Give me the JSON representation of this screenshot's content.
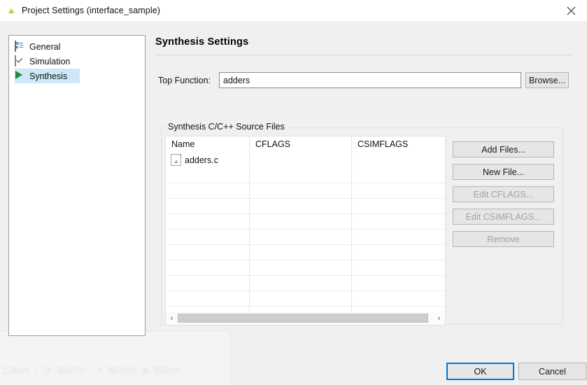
{
  "window": {
    "title": "Project Settings (interface_sample)",
    "icon": "app-icon",
    "close_label": "✕"
  },
  "sidebar": {
    "items": [
      {
        "label": "General",
        "icon": "list-icon",
        "selected": false
      },
      {
        "label": "Simulation",
        "icon": "checkbox-icon",
        "selected": false
      },
      {
        "label": "Synthesis",
        "icon": "play-icon",
        "selected": true
      }
    ]
  },
  "main": {
    "heading": "Synthesis Settings",
    "top_function": {
      "label": "Top Function:",
      "value": "adders",
      "placeholder": "",
      "browse_label": "Browse..."
    },
    "group": {
      "legend": "Synthesis C/C++ Source Files",
      "table": {
        "columns": [
          "Name",
          "CFLAGS",
          "CSIMFLAGS"
        ],
        "rows": [
          {
            "name": "adders.c",
            "icon": "c-file-icon",
            "cflags": "",
            "csimflags": ""
          }
        ],
        "empty_row_count": 10,
        "scrollbar": {
          "left_arrow": "‹",
          "right_arrow": "›"
        }
      },
      "actions": [
        {
          "label": "Add Files...",
          "enabled": true
        },
        {
          "label": "New File...",
          "enabled": true
        },
        {
          "label": "Edit CFLAGS...",
          "enabled": false
        },
        {
          "label": "Edit CSIMFLAGS...",
          "enabled": false
        },
        {
          "label": "Remove",
          "enabled": false
        }
      ]
    }
  },
  "footer": {
    "ok_label": "OK",
    "cancel_label": "Cancel"
  },
  "background": {
    "ghost_items": [
      "工具(M)",
      "▾",
      "调试(D)",
      "▾",
      "窗口(W)",
      "帮助(H)"
    ]
  },
  "colors": {
    "accent": "#0078d7",
    "selection": "#cde8f8",
    "play_green": "#1d8b3c",
    "dialog_bg": "#f0f0f0"
  }
}
